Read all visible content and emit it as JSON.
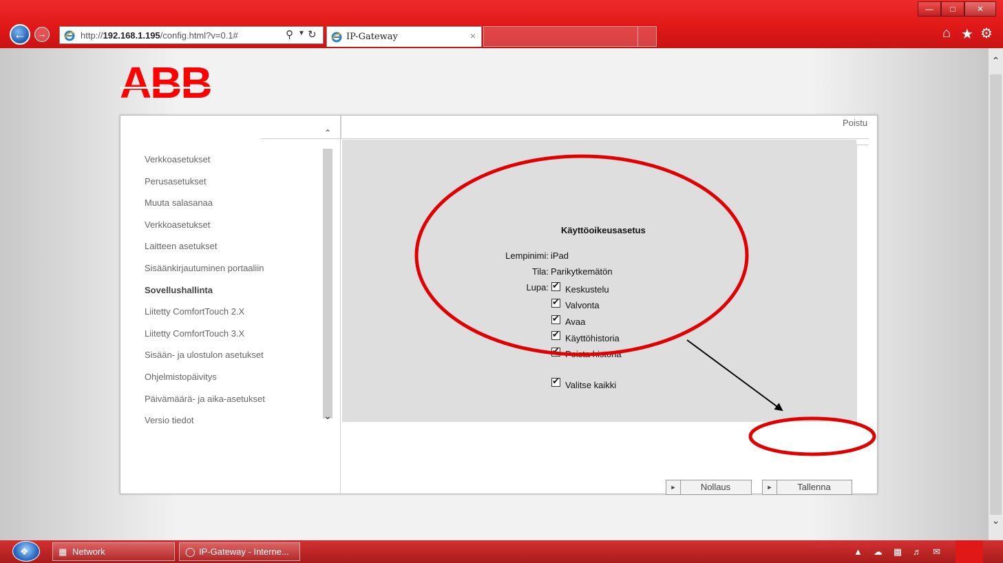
{
  "browser": {
    "url_prefix": "http://",
    "url_host": "192.168.1.195",
    "url_path": "/config.html?v=0.1#",
    "tab_title": "IP-Gateway",
    "tab_close": "×",
    "icons": [
      "back-icon",
      "forward-icon",
      "search-icon",
      "refresh-icon",
      "home-icon",
      "star-icon",
      "gear-icon"
    ]
  },
  "logo": {
    "text": "ABB",
    "color": "#ff0000"
  },
  "header": {
    "logout_label": "Poistu"
  },
  "sidebar": {
    "items": [
      {
        "label": "Verkkoasetukset",
        "active": false
      },
      {
        "label": "Perusasetukset",
        "active": false
      },
      {
        "label": "Muuta salasanaa",
        "active": false
      },
      {
        "label": "Verkkoasetukset",
        "active": false
      },
      {
        "label": "Laitteen asetukset",
        "active": false
      },
      {
        "label": "Sisäänkirjautuminen portaaliin",
        "active": false
      },
      {
        "label": "Sovellushallinta",
        "active": true
      },
      {
        "label": "Liitetty ComfortTouch 2.X",
        "active": false
      },
      {
        "label": "Liitetty ComfortTouch 3.X",
        "active": false
      },
      {
        "label": "Sisään- ja ulostulon asetukset",
        "active": false
      },
      {
        "label": "Ohjelmistopäivitys",
        "active": false
      },
      {
        "label": "Päivämäärä- ja aika-asetukset",
        "active": false
      },
      {
        "label": "Versio tiedot",
        "active": false
      }
    ]
  },
  "form": {
    "title": "Käyttöoikeusasetus",
    "nickname_label": "Lempinimi:",
    "nickname_value": "iPad",
    "status_label": "Tila:",
    "status_value": "Parikytkemätön",
    "permission_label": "Lupa:",
    "permissions": [
      {
        "label": "Keskustelu",
        "checked": true
      },
      {
        "label": "Valvonta",
        "checked": true
      },
      {
        "label": "Avaa",
        "checked": true
      },
      {
        "label": "Käyttöhistoria",
        "checked": true
      },
      {
        "label": "Poista historia",
        "checked": true
      }
    ],
    "select_all": {
      "label": "Valitse kaikki",
      "checked": true
    }
  },
  "buttons": {
    "reset_label": "Nollaus",
    "save_label": "Tallenna"
  },
  "annotation": {
    "color": "#e00000",
    "arrow_color": "#000000"
  },
  "taskbar": {
    "items": [
      {
        "label": "Network"
      },
      {
        "label": "IP-Gateway - Interne..."
      }
    ]
  },
  "colors": {
    "chrome_red": "#e01818",
    "panel_gray": "#dedede"
  }
}
